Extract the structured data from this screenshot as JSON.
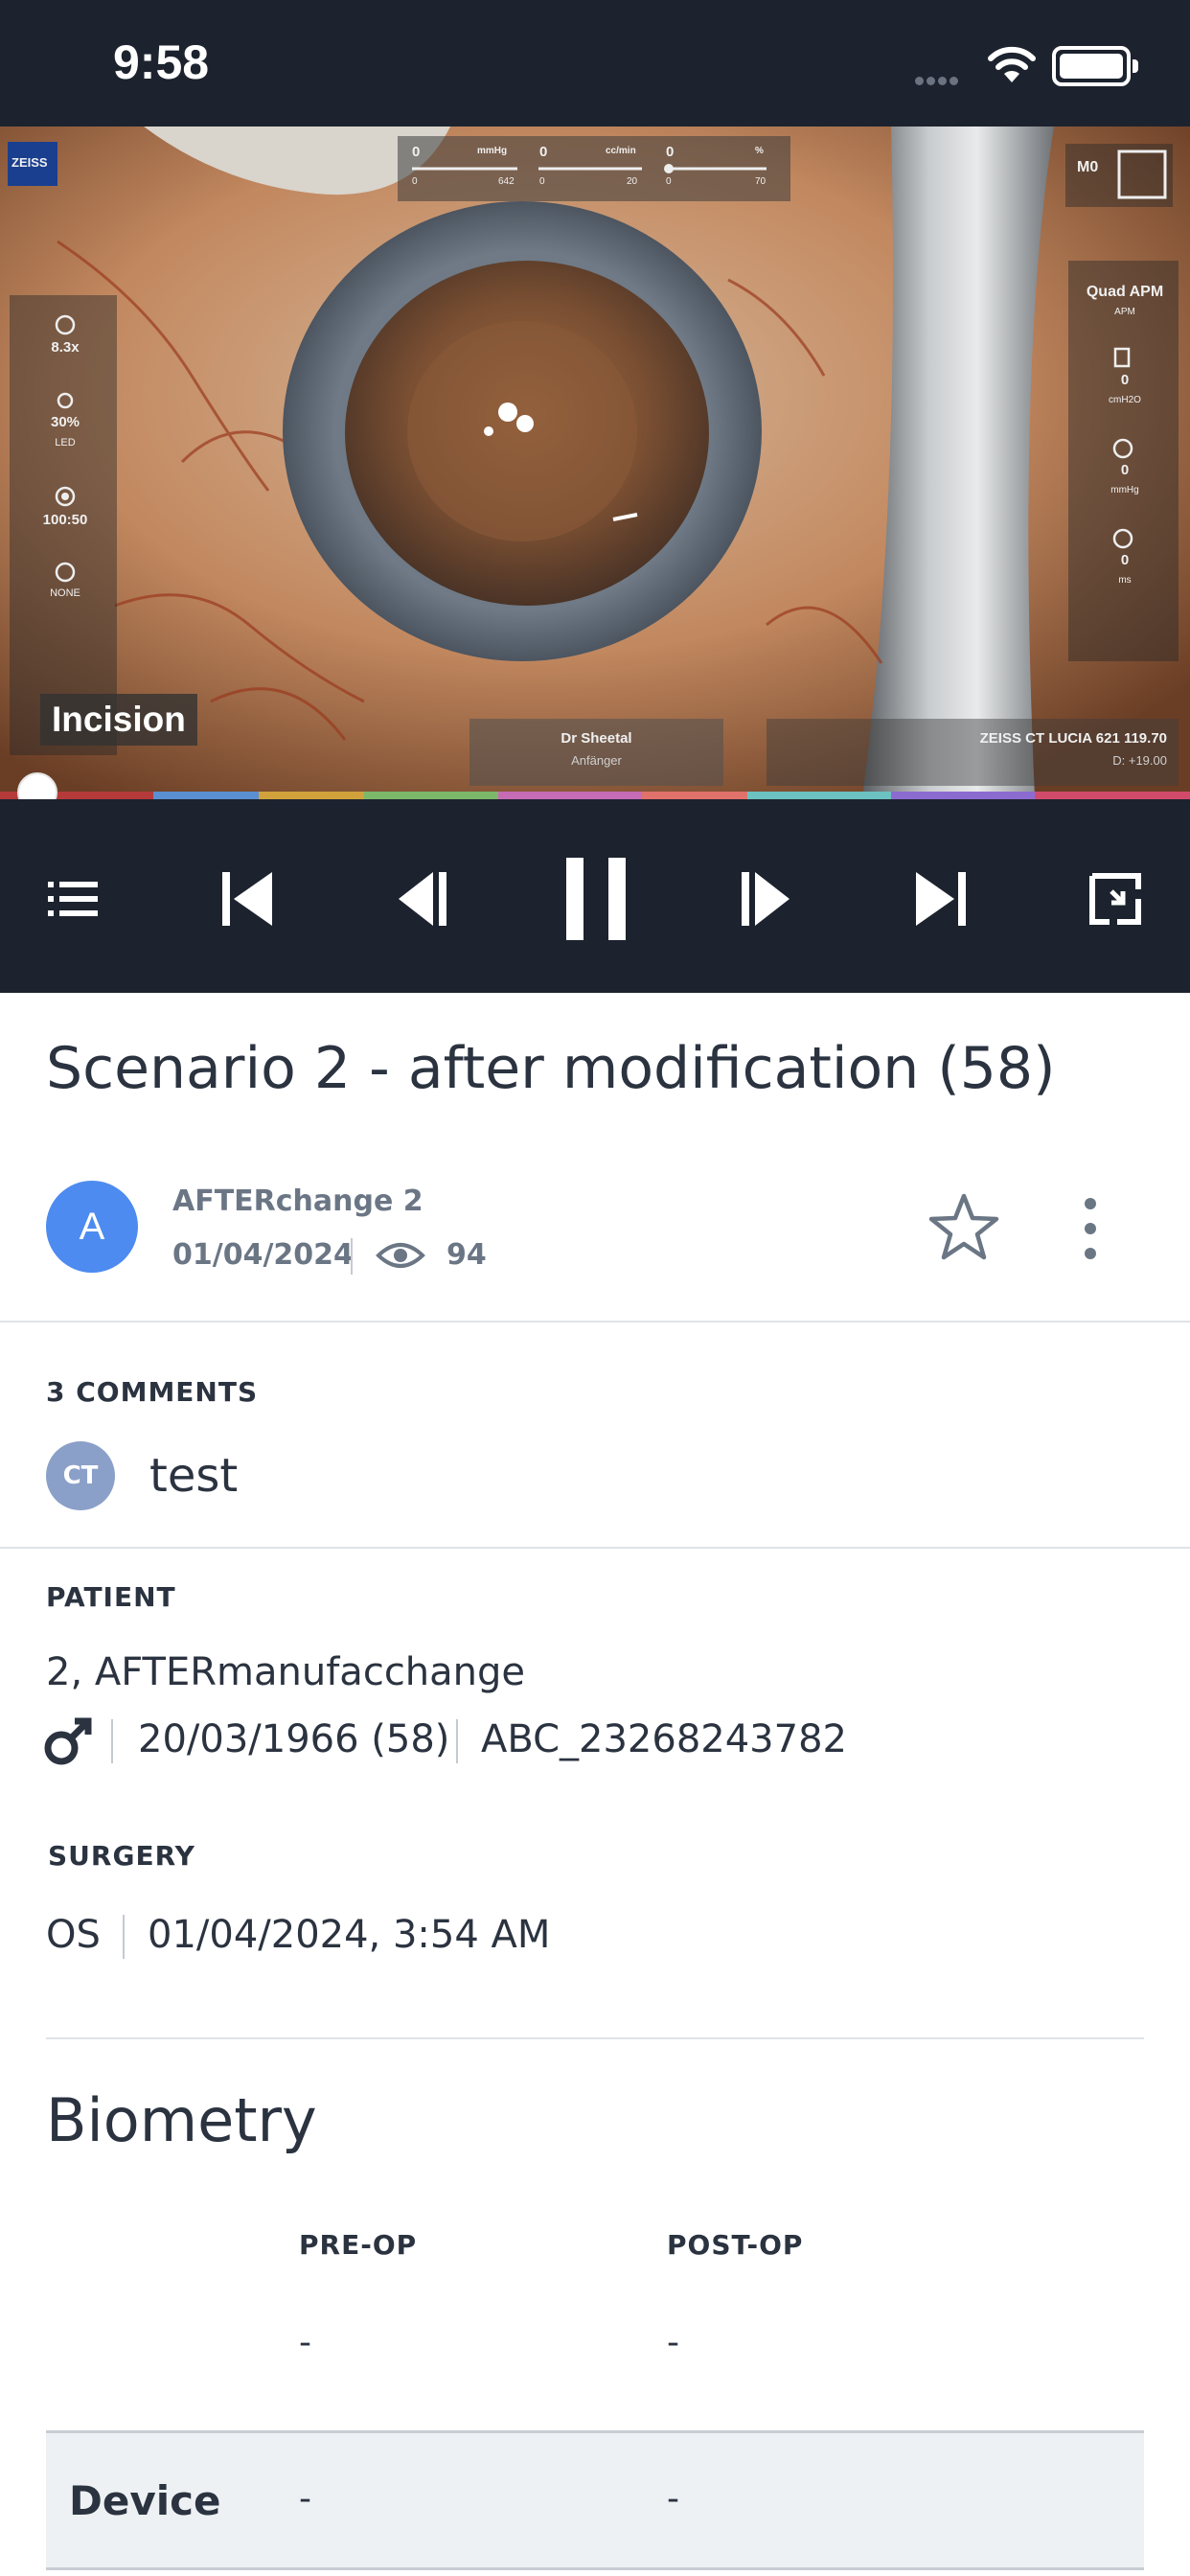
{
  "status_bar": {
    "time": "9:58"
  },
  "video": {
    "brand_logo": "ZEISS",
    "top_gauges": [
      {
        "value": "0",
        "unit": "mmHg",
        "min": "0",
        "max": "642"
      },
      {
        "value": "0",
        "unit": "cc/min",
        "min": "0",
        "max": "20"
      },
      {
        "value": "0",
        "unit": "%",
        "min": "0",
        "max": "70"
      }
    ],
    "mode_badge": "M0",
    "left_panel": [
      {
        "icon": "zoom-icon",
        "value": "8.3x",
        "label": ""
      },
      {
        "icon": "brightness-icon",
        "value": "30%",
        "label": "LED"
      },
      {
        "icon": "focus-icon",
        "value": "100:50",
        "label": ""
      },
      {
        "icon": "circle-icon",
        "value": "",
        "label": "NONE"
      }
    ],
    "right_panel": {
      "title": "Quad APM",
      "subtitle": "APM",
      "items": [
        {
          "value": "0",
          "unit": "cmH2O"
        },
        {
          "value": "0",
          "unit": "mmHg"
        },
        {
          "value": "0",
          "unit": "ms"
        }
      ]
    },
    "surgeon_name": "Dr Sheetal",
    "surgeon_sub": "Anfänger",
    "device_info": "ZEISS CT LUCIA 621 119.70",
    "device_info_sub": "D: +19.00",
    "chapter": "Incision",
    "progress_fraction": 0.02
  },
  "controls": {
    "icons": [
      "chapters-list-icon",
      "skip-back-icon",
      "step-back-icon",
      "pause-icon",
      "step-forward-icon",
      "skip-forward-icon",
      "fullscreen-toggle-icon"
    ]
  },
  "video_info": {
    "title": "Scenario 2 - after modification (58)",
    "avatar_initial": "A",
    "author": "AFTERchange 2",
    "date": "01/04/2024",
    "views": "94"
  },
  "comments": {
    "header": "3 COMMENTS",
    "latest": {
      "initials": "CT",
      "text": "test"
    }
  },
  "patient": {
    "header": "PATIENT",
    "name": "2, AFTERmanufacchange",
    "dob": "20/03/1966 (58)",
    "id": "ABC_23268243782"
  },
  "surgery": {
    "header": "SURGERY",
    "eye": "OS",
    "datetime": "01/04/2024, 3:54 AM"
  },
  "biometry": {
    "title": "Biometry",
    "columns": [
      "PRE-OP",
      "POST-OP"
    ],
    "header_row": [
      "-",
      "-"
    ],
    "rows": [
      {
        "label": "Device",
        "pre": "-",
        "post": "-"
      }
    ]
  },
  "colors": {
    "dark_bar": "#1c232e",
    "accent_blue": "#4d8bf0",
    "muted_text": "#6b7685"
  }
}
